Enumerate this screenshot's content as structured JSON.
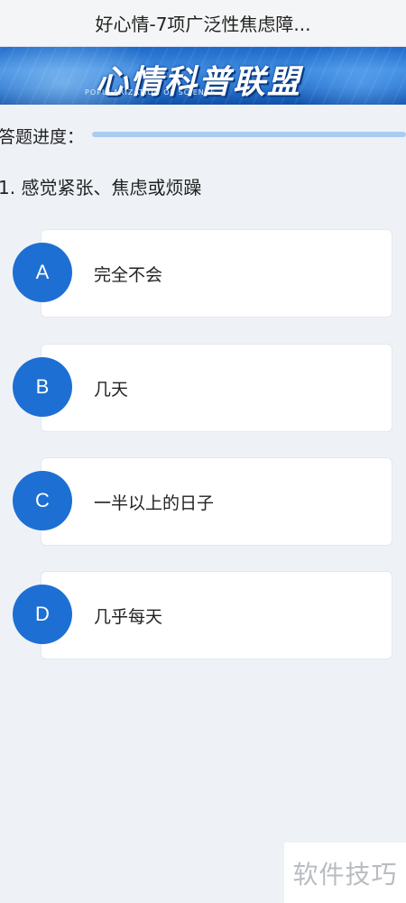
{
  "window": {
    "title": "好心情-7项广泛性焦虑障..."
  },
  "banner": {
    "title": "心情科普联盟",
    "subtitle": "POPULARIZATION OF SCIENCE"
  },
  "progress": {
    "label": "答题进度：",
    "fraction": 1.0
  },
  "question": {
    "text": "1. 感觉紧张、焦虑或烦躁"
  },
  "options": [
    {
      "letter": "A",
      "text": "完全不会"
    },
    {
      "letter": "B",
      "text": "几天"
    },
    {
      "letter": "C",
      "text": "一半以上的日子"
    },
    {
      "letter": "D",
      "text": "几乎每天"
    }
  ],
  "watermark": {
    "text": "软件技巧"
  },
  "colors": {
    "accent": "#1d6fd3",
    "background": "#eef2f7",
    "progress": "#a9cdf0"
  }
}
